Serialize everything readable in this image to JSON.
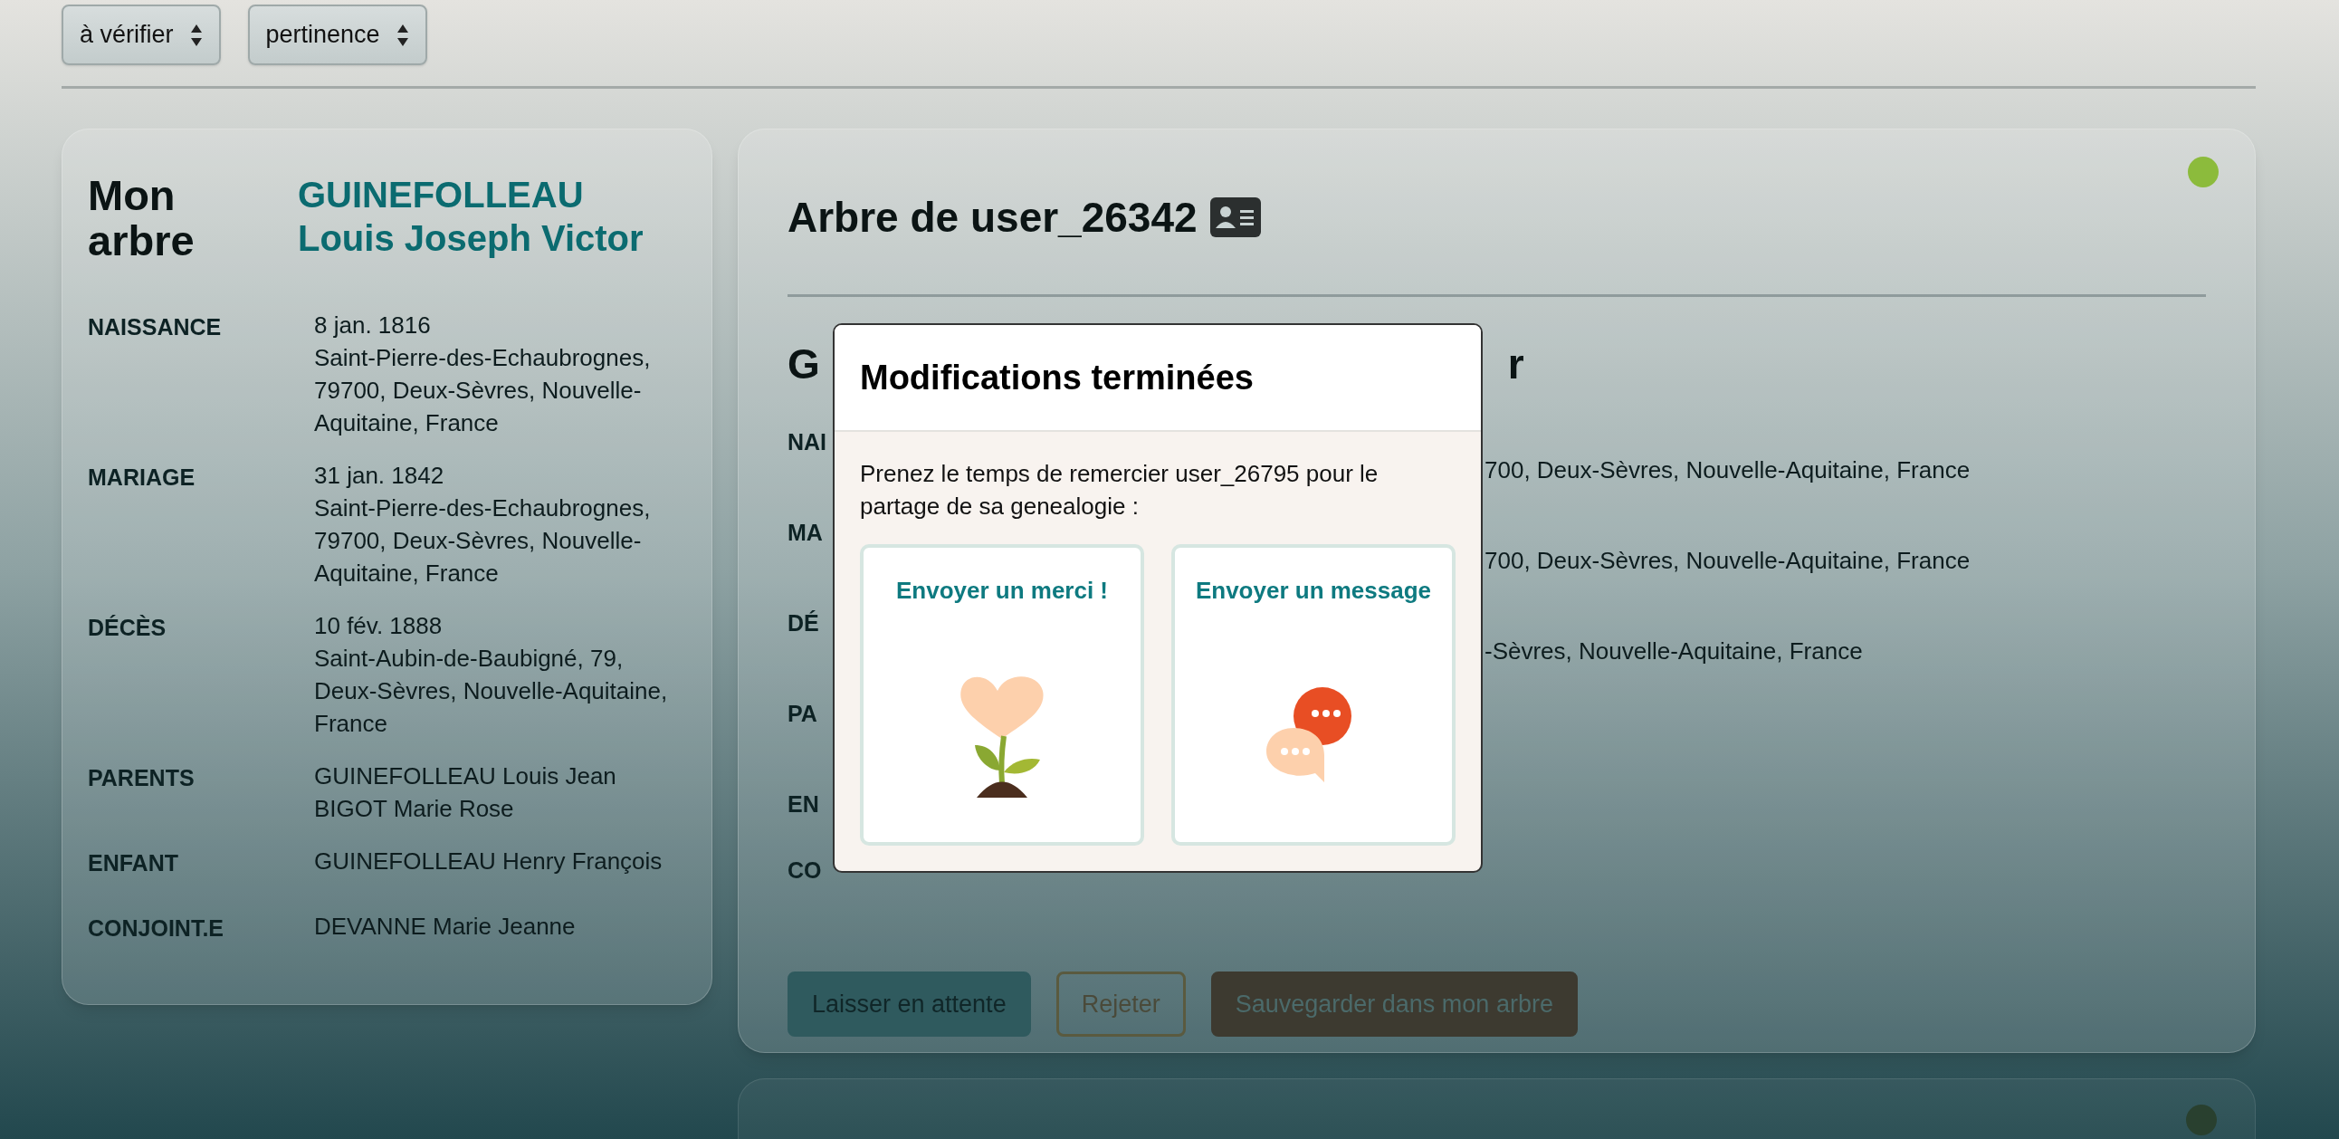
{
  "filters": [
    {
      "value": "à vérifier"
    },
    {
      "value": "pertinence"
    }
  ],
  "my_tree": {
    "title": "Mon arbre",
    "surname": "GUINEFOLLEAU",
    "given_names": "Louis Joseph Victor",
    "facts": [
      {
        "label": "NAISSANCE",
        "lines": [
          "8 jan. 1816",
          "Saint-Pierre-des-Echaubrognes, 79700, Deux-Sèvres, Nouvelle-Aquitaine, France"
        ]
      },
      {
        "label": "MARIAGE",
        "lines": [
          "31 jan. 1842",
          "Saint-Pierre-des-Echaubrognes, 79700, Deux-Sèvres, Nouvelle-Aquitaine, France"
        ]
      },
      {
        "label": "DÉCÈS",
        "lines": [
          "10 fév. 1888",
          "Saint-Aubin-de-Baubigné, 79, Deux-Sèvres, Nouvelle-Aquitaine, France"
        ]
      },
      {
        "label": "PARENTS",
        "lines": [
          "GUINEFOLLEAU Louis Jean",
          "BIGOT Marie Rose"
        ]
      },
      {
        "label": "ENFANT",
        "lines": [
          "GUINEFOLLEAU Henry François"
        ]
      },
      {
        "label": "CONJOINT.E",
        "lines": [
          "DEVANNE Marie Jeanne"
        ]
      }
    ]
  },
  "other_tree": {
    "title": "Arbre de user_26342",
    "color": "#8cbb3c",
    "heading_start": "G",
    "heading_end": "r",
    "facts": [
      {
        "label": "NAI",
        "value": "700, Deux-Sèvres, Nouvelle-Aquitaine, France"
      },
      {
        "label": "MA",
        "value": "700, Deux-Sèvres, Nouvelle-Aquitaine, France"
      },
      {
        "label": "DÉ",
        "value": "-Sèvres, Nouvelle-Aquitaine, France"
      },
      {
        "label": "PA"
      },
      {
        "label": "EN"
      },
      {
        "label": "CO"
      }
    ],
    "buttons": [
      {
        "kind": "hold",
        "label": "Laisser en attente"
      },
      {
        "kind": "reject",
        "label": "Rejeter"
      },
      {
        "kind": "save",
        "label": "Sauvegarder dans mon arbre"
      }
    ]
  },
  "next_tree": {
    "color": "#29402f"
  },
  "modal": {
    "title": "Modifications terminées",
    "text": "Prenez le temps de remercier user_26795 pour le partage de sa genealogie :",
    "options": [
      {
        "kind": "thanks",
        "label": "Envoyer un merci !"
      },
      {
        "kind": "message",
        "label": "Envoyer un message"
      }
    ]
  }
}
